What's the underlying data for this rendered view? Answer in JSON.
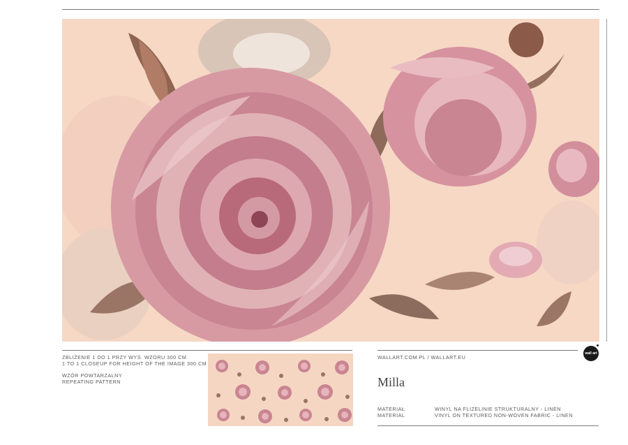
{
  "header": {},
  "main_image": {
    "alt_subject": "rose-watercolor"
  },
  "closeup": {
    "line1": "ZBLIŻENIE 1 DO 1 PRZY WYS. WZORU 300 CM",
    "line2": "1 TO 1 CLOSEUP FOR HEIGHT OF THE IMAGE 300 CM"
  },
  "pattern": {
    "line1": "WZÓR POWTARZALNY",
    "line2": "REPEATING PATTERN"
  },
  "brand": {
    "sites": "WALLART.COM.PL / WALLART.EU",
    "logo_text": "wall art"
  },
  "product": {
    "name": "Milla"
  },
  "material": {
    "label_pl": "MATERIAŁ",
    "label_en": "MATERIAL",
    "value_pl": "WINYL NA FLIZELINIE STRUKTURALNY - LINEN",
    "value_en": "VINYL ON TEXTURED NON-WOVEN FABRIC - LINEN"
  },
  "colors": {
    "background": "#f6d8c4",
    "rose": "#c47d8c",
    "rose_dark": "#8e4555",
    "leaf": "#8a6a58"
  }
}
